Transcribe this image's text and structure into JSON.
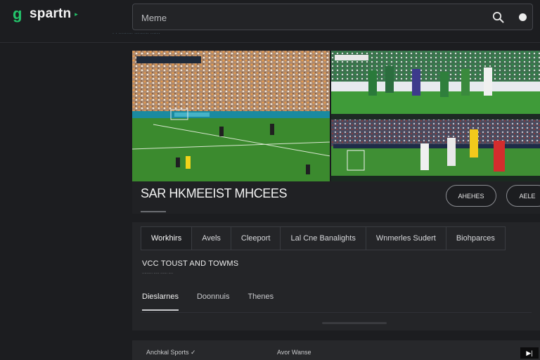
{
  "header": {
    "logo_mark": "g",
    "logo_text": "spartn",
    "logo_chevron": "▸",
    "search_placeholder": "Meme",
    "nav_text": "·  · ·········   ·········   ······"
  },
  "hero": {
    "title": "SAR HKMEEIST MHCEES",
    "button_1": "AHEHES",
    "button_2": "AELE"
  },
  "tabs": [
    "Workhirs",
    "Avels",
    "Cleeport",
    "Lal Cne Banalights",
    "Wnmerles Sudert",
    "Biohparces"
  ],
  "section": {
    "title": "VCC TOUST AND TOWMS",
    "subline": "·········  ·····  ······  ····"
  },
  "subtabs": [
    "Dieslarnes",
    "Doonnuis",
    "Thenes"
  ],
  "bottom": {
    "item_1": "Anchkal Sports ✓",
    "item_2": "Avor Wanse",
    "corner": "▶|"
  },
  "colors": {
    "accent": "#23c46a",
    "background": "#1c1d20",
    "pitch": "#2f7d2a"
  }
}
